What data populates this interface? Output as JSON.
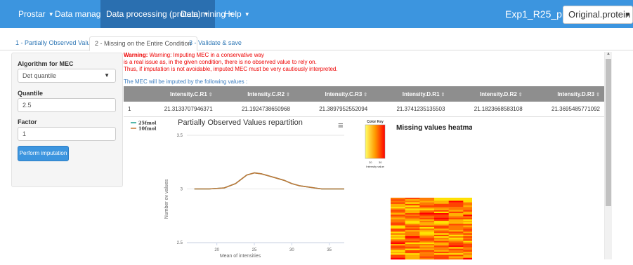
{
  "nav": {
    "items": [
      {
        "label": "Prostar",
        "caret": true
      },
      {
        "label": "Data manager",
        "caret": true
      },
      {
        "label": "Data processing (protein)",
        "caret": true,
        "active": true
      },
      {
        "label": "Data mining",
        "caret": true
      },
      {
        "label": "Help",
        "caret": true
      }
    ],
    "project": "Exp1_R25_prot",
    "dataset_selected": "Original.protein"
  },
  "tabs": [
    {
      "label": "1 - Partially Observed Values"
    },
    {
      "label": "2 - Missing on the Entire Condition",
      "active": true
    },
    {
      "label": "3 - Validate & save"
    }
  ],
  "sidebar": {
    "algorithm_label": "Algorithm for MEC",
    "algorithm_value": "Det quantile",
    "quantile_label": "Quantile",
    "quantile_value": "2.5",
    "factor_label": "Factor",
    "factor_value": "1",
    "perform_label": "Perform imputation"
  },
  "warning": {
    "prefix": "Warning:",
    "line1": " Warning: Imputing MEC in a conservative way",
    "line2": "is a real issue as, in the given condition, there is no observed value to rely on.",
    "line3": "Thus, if imputation is not avoidable, imputed MEC must be very cautiously interpreted.",
    "note": "The MEC will be imputed by the following values :"
  },
  "values_table": {
    "headers": [
      "",
      "Intensity.C.R1",
      "Intensity.C.R2",
      "Intensity.C.R3",
      "Intensity.D.R1",
      "Intensity.D.R2",
      "Intensity.D.R3"
    ],
    "rows": [
      [
        "1",
        "21.3133707946371",
        "21.1924738650968",
        "21.3897952552094",
        "21.3741235135503",
        "21.1823668583108",
        "21.3695485771092"
      ]
    ]
  },
  "chart_data": {
    "type": "line",
    "title": "Partially Observed Values repartition",
    "xlabel": "Mean of intensities",
    "ylabel": "Number ov values",
    "xlim": [
      16,
      37
    ],
    "ylim": [
      2.5,
      3.5
    ],
    "x_ticks": [
      20,
      25,
      30,
      35
    ],
    "y_ticks": [
      2.5,
      3,
      3.5
    ],
    "legend_position": "top-left",
    "series": [
      {
        "name": "25fmol",
        "color": "#1a9e8c",
        "x": [
          17,
          19,
          21,
          22.5,
          24,
          25,
          26,
          27,
          28,
          29,
          30,
          31,
          32,
          33,
          34,
          35,
          36,
          37
        ],
        "y": [
          3,
          3,
          3.01,
          3.05,
          3.13,
          3.15,
          3.14,
          3.12,
          3.1,
          3.08,
          3.05,
          3.03,
          3.02,
          3.01,
          3,
          3,
          3,
          3
        ]
      },
      {
        "name": "10fmol",
        "color": "#c87533",
        "x": [
          17,
          19,
          21,
          22.5,
          24,
          25,
          26,
          27,
          28,
          29,
          30,
          31,
          32,
          33,
          34,
          35,
          36,
          37
        ],
        "y": [
          3,
          3,
          3.01,
          3.05,
          3.13,
          3.15,
          3.14,
          3.12,
          3.1,
          3.08,
          3.05,
          3.03,
          3.02,
          3.01,
          3,
          3,
          3,
          3
        ]
      }
    ]
  },
  "heatmap": {
    "title": "Missing values heatmap",
    "key_title": "Color Key",
    "key_ticks": [
      "20",
      "30"
    ],
    "key_label": "Intensity value",
    "colors": [
      "#ff0000",
      "#ff4400",
      "#ff7a00",
      "#ffb000",
      "#ffe000",
      "#ffff66"
    ]
  }
}
